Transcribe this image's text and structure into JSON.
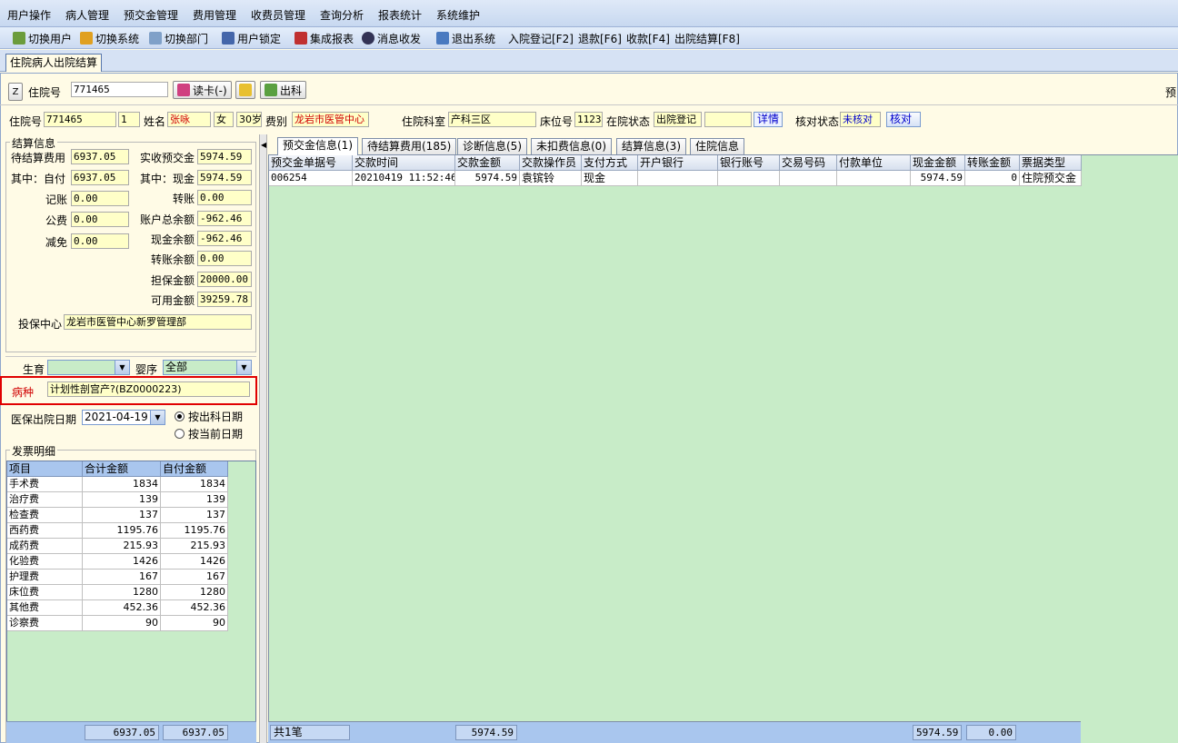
{
  "menu": [
    "用户操作",
    "病人管理",
    "预交金管理",
    "费用管理",
    "收费员管理",
    "查询分析",
    "报表统计",
    "系统维护"
  ],
  "toolbar": {
    "switch_user": "切换用户",
    "switch_system": "切换系统",
    "switch_dept": "切换部门",
    "lock_user": "用户锁定",
    "report": "集成报表",
    "message": "消息收发",
    "exit": "退出系统",
    "admit": "入院登记[F2]",
    "refund": "退款[F6]",
    "charge": "收款[F4]",
    "discharge": "出院结算[F8]"
  },
  "main_tab": "住院病人出院结算",
  "search": {
    "label": "住院号",
    "value": "771465",
    "read_card": "读卡(-)",
    "discharge_btn": "出科",
    "right_label": "预"
  },
  "patient": {
    "id_label": "住院号",
    "id": "771465",
    "seq": "1",
    "name_label": "姓名",
    "name": "张咏",
    "sex": "女",
    "age": "30岁",
    "fee_label": "费别",
    "fee_type": "龙岩市医管中心",
    "dept_label": "住院科室",
    "dept": "产科三区",
    "bed_label": "床位号",
    "bed": "1123",
    "status_label": "在院状态",
    "status": "出院登记",
    "status2": "",
    "detail": "详情",
    "check_label": "核对状态",
    "check": "未核对",
    "check_btn": "核对"
  },
  "settle": {
    "title": "结算信息",
    "pending_label": "待结算费用",
    "pending": "6937.05",
    "self_label": "其中：自付",
    "self": "6937.05",
    "account_label": "记账",
    "account": "0.00",
    "public_label": "公费",
    "public": "0.00",
    "reduce_label": "减免",
    "reduce": "0.00",
    "prepaid_label": "实收预交金",
    "prepaid": "5974.59",
    "cash_label": "其中：现金",
    "cash": "5974.59",
    "transfer_label": "转账",
    "transfer": "0.00",
    "total_bal_label": "账户总余额",
    "total_bal": "-962.46",
    "cash_bal_label": "现金余额",
    "cash_bal": "-962.46",
    "transfer_bal_label": "转账余额",
    "transfer_bal": "0.00",
    "guarantee_label": "担保金额",
    "guarantee": "20000.00",
    "avail_label": "可用金额",
    "avail": "39259.78",
    "insurer_label": "投保中心",
    "insurer": "龙岩市医管中心新罗管理部"
  },
  "birth": {
    "label": "生育",
    "value": "",
    "order_label": "婴序",
    "order": "全部"
  },
  "disease": {
    "label": "病种",
    "value": "计划性剖宫产?(BZ0000223)"
  },
  "discharge": {
    "label": "医保出院日期",
    "date": "2021-04-19",
    "opt1": "按出科日期",
    "opt2": "按当前日期"
  },
  "invoice": {
    "title": "发票明细",
    "headers": [
      "项目",
      "合计金额",
      "自付金额"
    ],
    "rows": [
      [
        "手术费",
        "1834",
        "1834"
      ],
      [
        "治疗费",
        "139",
        "139"
      ],
      [
        "检查费",
        "137",
        "137"
      ],
      [
        "西药费",
        "1195.76",
        "1195.76"
      ],
      [
        "成药费",
        "215.93",
        "215.93"
      ],
      [
        "化验费",
        "1426",
        "1426"
      ],
      [
        "护理费",
        "167",
        "167"
      ],
      [
        "床位费",
        "1280",
        "1280"
      ],
      [
        "其他费",
        "452.36",
        "452.36"
      ],
      [
        "诊察费",
        "90",
        "90"
      ]
    ],
    "total": "6937.05",
    "total_self": "6937.05"
  },
  "tabs": [
    "预交金信息(1)",
    "待结算费用(185)",
    "诊断信息(5)",
    "未扣费信息(0)",
    "结算信息(3)",
    "住院信息"
  ],
  "grid": {
    "headers": [
      "预交金单据号",
      "交款时间",
      "交款金额",
      "交款操作员",
      "支付方式",
      "开户银行",
      "银行账号",
      "交易号码",
      "付款单位",
      "现金金额",
      "转账金额",
      "票据类型"
    ],
    "rows": [
      [
        "006254",
        "20210419 11:52:46",
        "5974.59",
        "袁镔铃",
        "现金",
        "",
        "",
        "",
        "",
        "5974.59",
        "0",
        "住院预交金"
      ]
    ],
    "footer_count": "共1笔",
    "footer_amount": "5974.59",
    "footer_cash": "5974.59",
    "footer_transfer": "0.00"
  },
  "colors": {
    "highlight": "#e00000",
    "field_bg": "#ffffc8",
    "grid_bg": "#c8ecc8"
  }
}
